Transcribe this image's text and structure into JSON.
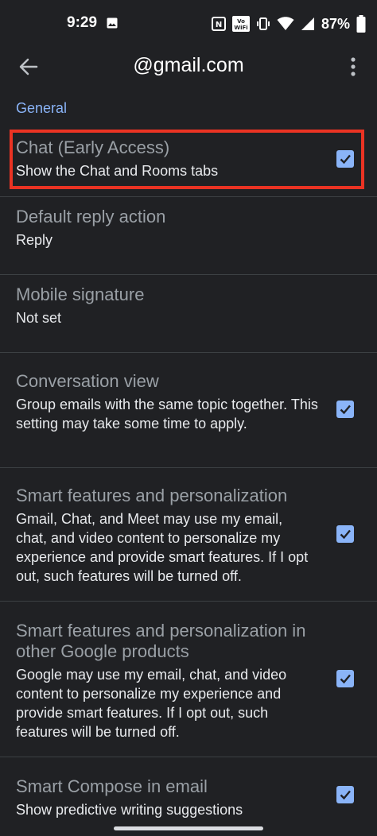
{
  "status_bar": {
    "time": "9:29",
    "battery": "87%",
    "icons": [
      "image-icon",
      "nfc-icon",
      "vo-wifi-icon",
      "vibrate-icon",
      "wifi-icon",
      "signal-icon",
      "battery-icon"
    ]
  },
  "app_bar": {
    "title": "@gmail.com",
    "back_icon": "arrow-left-icon",
    "menu_icon": "more-vert-icon"
  },
  "section": {
    "title": "General"
  },
  "settings": [
    {
      "title": "Chat (Early Access)",
      "subtitle": "Show the Chat and Rooms tabs",
      "checked": true
    },
    {
      "title": "Default reply action",
      "subtitle": "Reply"
    },
    {
      "title": "Mobile signature",
      "subtitle": "Not set"
    },
    {
      "title": "Conversation view",
      "subtitle": "Group emails with the same topic together. This setting may take some time to apply.",
      "checked": true
    },
    {
      "title": "Smart features and personalization",
      "subtitle": "Gmail, Chat, and Meet may use my email, chat, and video content to personalize my experience and provide smart features. If I opt out, such features will be turned off.",
      "checked": true
    },
    {
      "title": "Smart features and personalization in other Google products",
      "subtitle": "Google may use my email, chat, and video content to personalize my experience and provide smart features. If I opt out, such features will be turned off.",
      "checked": true
    },
    {
      "title": "Smart Compose in email",
      "subtitle": "Show predictive writing suggestions",
      "checked": true
    }
  ],
  "colors": {
    "background": "#202124",
    "accent": "#8ab4f8",
    "highlight": "#ea3323",
    "divider": "#3c4043"
  }
}
